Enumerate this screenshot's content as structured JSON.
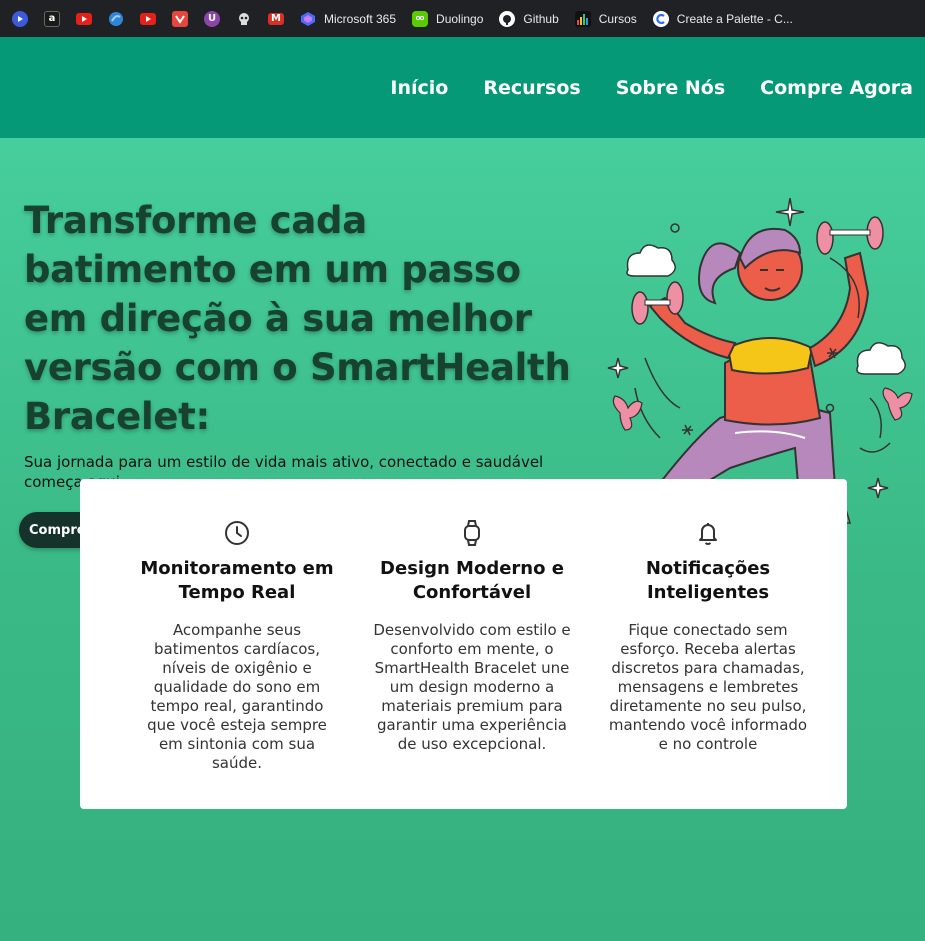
{
  "bookmarks": [
    {
      "label": "",
      "icon": "video-icon",
      "color": "#3b5bdb"
    },
    {
      "label": "",
      "icon": "a-logo-icon",
      "color": "#1a1a1a"
    },
    {
      "label": "",
      "icon": "youtube-icon",
      "color": "#e62117"
    },
    {
      "label": "",
      "icon": "drop-icon",
      "color": "#2f86d6"
    },
    {
      "label": "",
      "icon": "youtube-icon",
      "color": "#e62117"
    },
    {
      "label": "",
      "icon": "shield-icon",
      "color": "#e8453c"
    },
    {
      "label": "",
      "icon": "u-logo-icon",
      "color": "#8e44ad"
    },
    {
      "label": "",
      "icon": "skull-icon",
      "color": "#555555"
    },
    {
      "label": "",
      "icon": "gmail-icon",
      "color": "#d93025"
    },
    {
      "label": "Microsoft 365",
      "icon": "microsoft-365-icon",
      "color": "#4a6cf7"
    },
    {
      "label": "Duolingo",
      "icon": "duolingo-icon",
      "color": "#58cc02"
    },
    {
      "label": "Github",
      "icon": "github-icon",
      "color": "#ffffff"
    },
    {
      "label": "Cursos",
      "icon": "bars-icon",
      "color": "#f2c12e"
    },
    {
      "label": "Create a Palette - C...",
      "icon": "palette-icon",
      "color": "#ffffff"
    }
  ],
  "nav": {
    "items": [
      "Início",
      "Recursos",
      "Sobre Nós",
      "Compre Agora"
    ]
  },
  "hero": {
    "title": "Transforme cada batimento em um passo em direção à sua melhor versão com o SmartHealth Bracelet:",
    "subtitle": "Sua jornada para um estilo de vida mais ativo, conectado e saudável começa aqui",
    "cta": "Compre Agora"
  },
  "features": [
    {
      "icon": "clock-icon",
      "title": "Monitoramento em Tempo Real",
      "text": "Acompanhe seus batimentos cardíacos, níveis de oxigênio e qualidade do sono em tempo real, garantindo que você esteja sempre em sintonia com sua saúde."
    },
    {
      "icon": "watch-icon",
      "title": "Design Moderno e Confortável",
      "text": "Desenvolvido com estilo e conforto em mente, o SmartHealth Bracelet une um design moderno a materiais premium para garantir uma experiência de uso excepcional."
    },
    {
      "icon": "bell-icon",
      "title": "Notificações Inteligentes",
      "text": "Fique conectado sem esforço. Receba alertas discretos para chamadas, mensagens e lembretes diretamente no seu pulso, mantendo você informado e no controle"
    }
  ],
  "colors": {
    "header": "#069978",
    "hero_top": "#46ce9c",
    "title": "#16422f",
    "button": "#15332a"
  }
}
